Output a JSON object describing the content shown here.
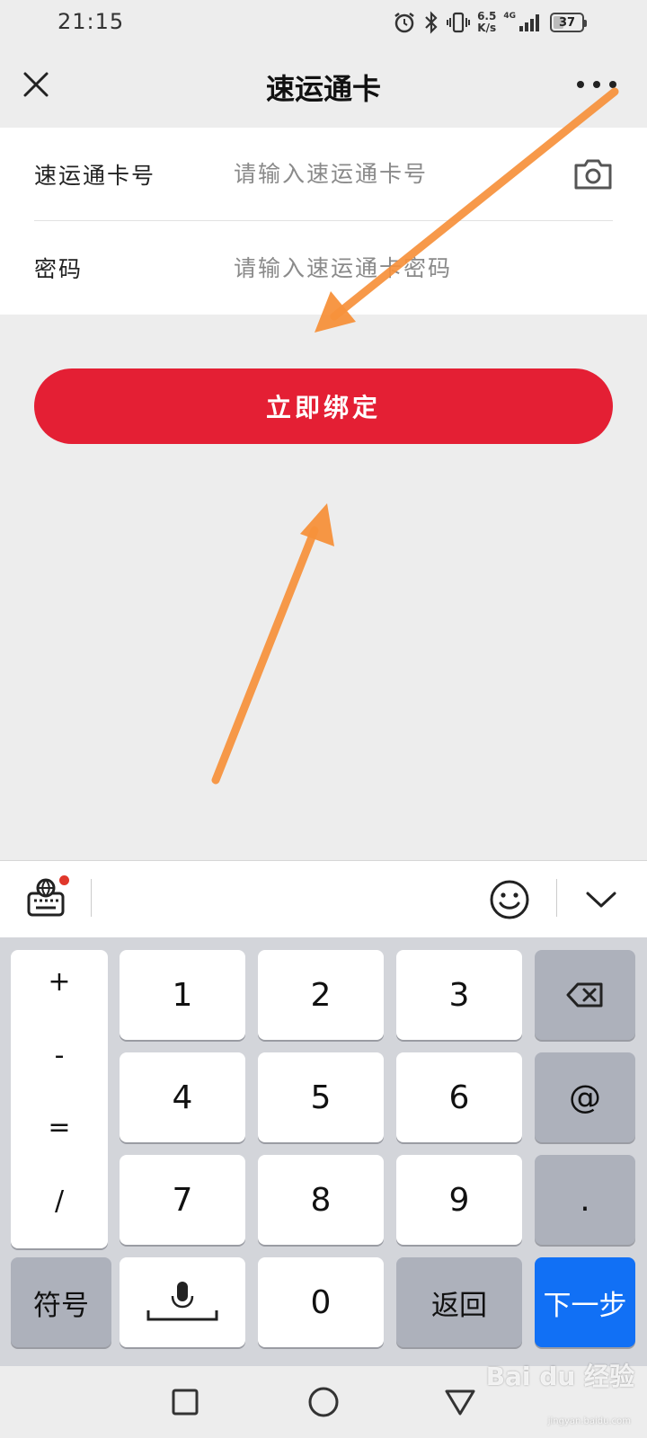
{
  "status_bar": {
    "time": "21:15",
    "net_speed_value": "6.5",
    "net_speed_unit": "K/s",
    "network_type": "4G",
    "battery_level": "37",
    "battery_fraction": 0.37
  },
  "nav": {
    "title": "速运通卡"
  },
  "form": {
    "card_number_label": "速运通卡号",
    "card_number_placeholder": "请输入速运通卡号",
    "card_number_value": "",
    "password_label": "密码",
    "password_placeholder": "请输入速运通卡密码",
    "password_value": ""
  },
  "bind_button_label": "立即绑定",
  "keyboard": {
    "symbols": [
      "+",
      "-",
      "=",
      "/"
    ],
    "digits": [
      "1",
      "2",
      "3",
      "4",
      "5",
      "6",
      "7",
      "8",
      "9",
      "0"
    ],
    "at_label": "@",
    "dot_label": ".",
    "symbols_key_label": "符号",
    "back_key_label": "返回",
    "next_key_label": "下一步"
  },
  "watermark": {
    "text": "Bai du 经验",
    "sub": "jingyan.baidu.com"
  },
  "colors": {
    "accent_red": "#e41f34",
    "annotation_orange": "#f7913b",
    "next_key_blue": "#1170f5"
  }
}
